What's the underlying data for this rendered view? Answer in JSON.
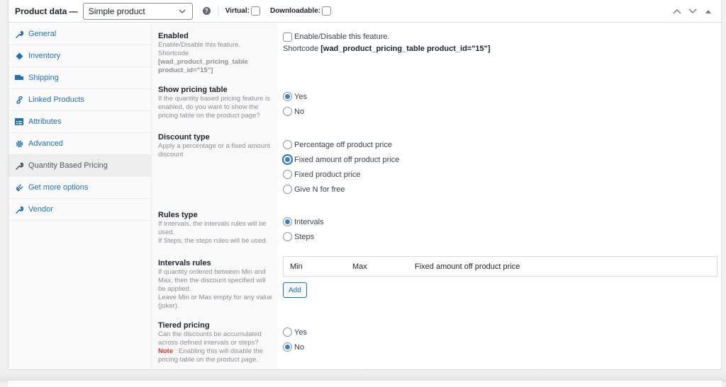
{
  "header": {
    "title": "Product data —",
    "product_type": "Simple product",
    "virtual_label": "Virtual:",
    "downloadable_label": "Downloadable:",
    "help_icon": "question-circle-icon",
    "actions": [
      "move-up-icon",
      "move-down-icon",
      "toggle-panel-icon"
    ]
  },
  "tabs": [
    {
      "label": "General",
      "icon": "wrench-icon",
      "active": false
    },
    {
      "label": "Inventory",
      "icon": "tag-icon",
      "active": false
    },
    {
      "label": "Shipping",
      "icon": "truck-icon",
      "active": false
    },
    {
      "label": "Linked Products",
      "icon": "link-icon",
      "active": false
    },
    {
      "label": "Attributes",
      "icon": "list-icon",
      "active": false
    },
    {
      "label": "Advanced",
      "icon": "gear-icon",
      "active": false
    },
    {
      "label": "Quantity Based Pricing",
      "icon": "wrench-icon",
      "active": true
    },
    {
      "label": "Get more options",
      "icon": "plugin-icon",
      "active": false
    },
    {
      "label": "Vendor",
      "icon": "wrench-icon",
      "active": false
    }
  ],
  "fields": {
    "enabled": {
      "label": "Enabled",
      "desc1": "Enable/Disable this feature.",
      "desc2": "Shortcode",
      "desc3": "[wad_product_pricing_table product_id=\"15\"]",
      "checkbox_label": "Enable/Disable this feature.",
      "checked": false,
      "shortcode_prefix": "Shortcode",
      "shortcode_value": "[wad_product_pricing_table product_id=\"15\"]"
    },
    "show_pricing_table": {
      "label": "Show pricing table",
      "desc": "If the quantity based pricing feature is enabled, do you want to show the pricing table on the product page?",
      "options": [
        "Yes",
        "No"
      ],
      "selected": "Yes"
    },
    "discount_type": {
      "label": "Discount type",
      "desc": "Apply a percentage or a fixed amount discount",
      "options": [
        "Percentage off product price",
        "Fixed amount off product price",
        "Fixed product price",
        "Give N for free"
      ],
      "selected": "Fixed amount off product price"
    },
    "rules_type": {
      "label": "Rules type",
      "desc1": "If Intervals, the intervals rules will be used.",
      "desc2": "If Steps, the steps rules will be used.",
      "options": [
        "Intervals",
        "Steps"
      ],
      "selected": "Intervals"
    },
    "intervals_rules": {
      "label": "Intervals rules",
      "desc1": "If quantity ordered between Min and Max, then the discount specified will be applied.",
      "desc2": "Leave Min or Max empty for any value (joker).",
      "columns": [
        "Min",
        "Max",
        "Fixed amount off product price"
      ],
      "add_label": "Add"
    },
    "tiered_pricing": {
      "label": "Tiered pricing",
      "desc": "Can the discounts be accumulated across defined intervals or steps?",
      "note_label": "Note",
      "note_text": " : Enabling this will disable the pricing table on the product page.",
      "options": [
        "Yes",
        "No"
      ],
      "selected": "No"
    }
  },
  "colors": {
    "accent": "#2271b1",
    "radio_dot": "#3582c4",
    "note": "#d63638"
  }
}
